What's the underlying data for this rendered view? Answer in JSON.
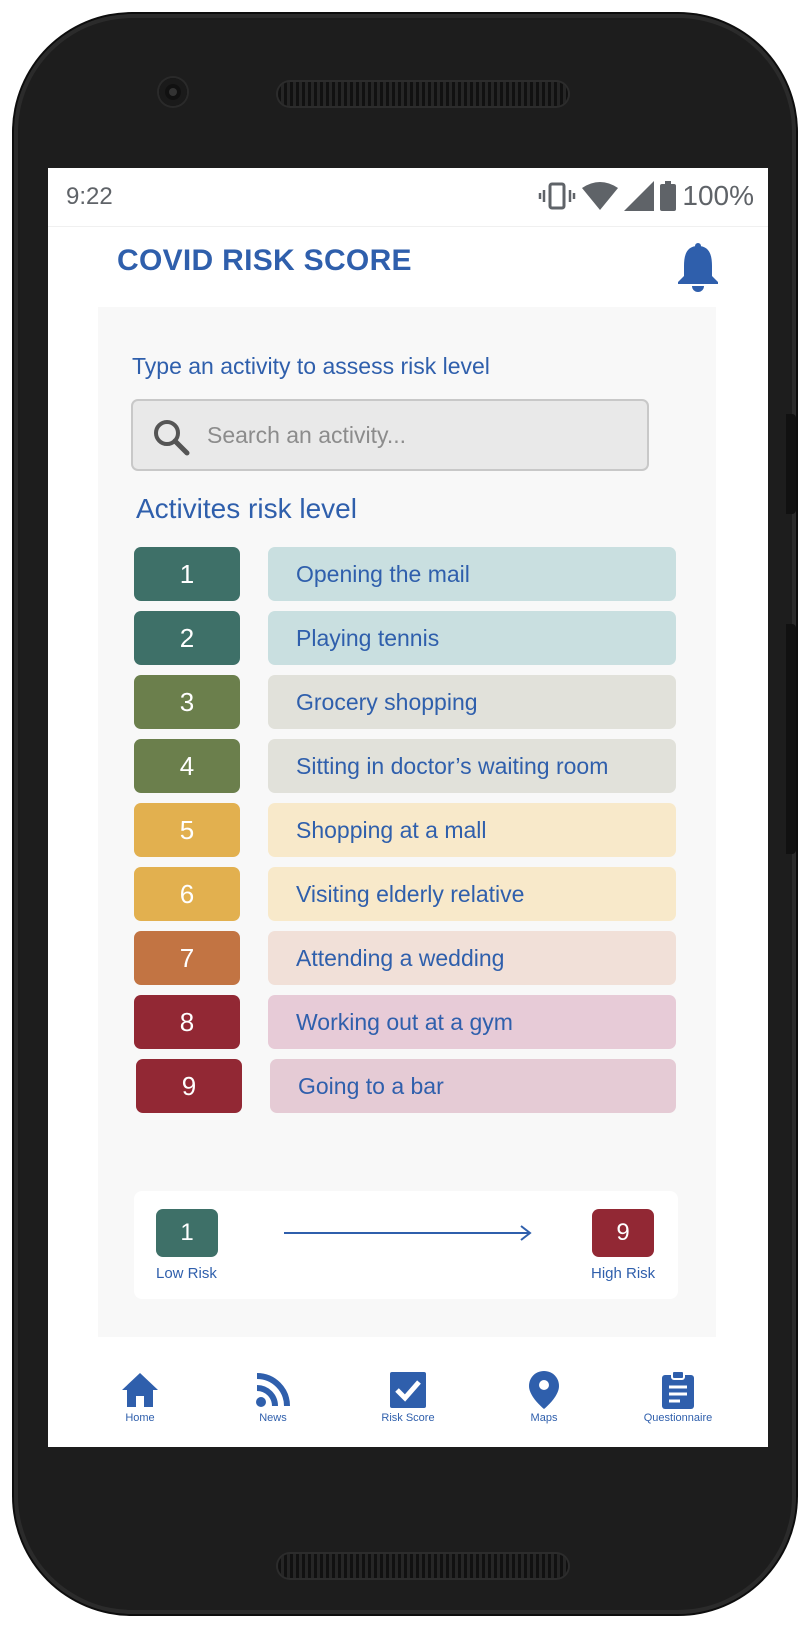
{
  "status_bar": {
    "time": "9:22",
    "battery": "100%"
  },
  "header": {
    "title": "COVID RISK SCORE"
  },
  "search": {
    "prompt": "Type an activity to assess risk level",
    "placeholder": "Search an activity..."
  },
  "activities": {
    "title": "Activites risk level",
    "items": [
      {
        "level": "1",
        "label": "Opening the mail",
        "badge_color": "#3e7068",
        "row_color": "#c9dfe0"
      },
      {
        "level": "2",
        "label": "Playing tennis",
        "badge_color": "#3e7068",
        "row_color": "#c9dfe0"
      },
      {
        "level": "3",
        "label": "Grocery shopping",
        "badge_color": "#6b7f4c",
        "row_color": "#e1e1da"
      },
      {
        "level": "4",
        "label": "Sitting in doctor’s waiting room",
        "badge_color": "#6b7f4c",
        "row_color": "#e1e1da"
      },
      {
        "level": "5",
        "label": "Shopping at a mall",
        "badge_color": "#e2b04f",
        "row_color": "#f8e9ca"
      },
      {
        "level": "6",
        "label": "Visiting elderly relative",
        "badge_color": "#e2b04f",
        "row_color": "#f8e9ca"
      },
      {
        "level": "7",
        "label": "Attending a wedding",
        "badge_color": "#c27443",
        "row_color": "#f1e0d8"
      },
      {
        "level": "8",
        "label": "Working out at a gym",
        "badge_color": "#922834",
        "row_color": "#e7cbd7"
      },
      {
        "level": "9",
        "label": "Going to a bar",
        "badge_color": "#922834",
        "row_color": "#e5cbd5"
      }
    ]
  },
  "legend": {
    "low": {
      "value": "1",
      "label": "Low Risk",
      "color": "#3e7068"
    },
    "high": {
      "value": "9",
      "label": "High Risk",
      "color": "#922834"
    }
  },
  "tab_bar": {
    "tabs": [
      {
        "label": "Home",
        "icon": "home-icon"
      },
      {
        "label": "News",
        "icon": "rss-icon"
      },
      {
        "label": "Risk Score",
        "icon": "checkbox-icon"
      },
      {
        "label": "Maps",
        "icon": "map-pin-icon"
      },
      {
        "label": "Questionnaire",
        "icon": "clipboard-icon"
      }
    ]
  },
  "colors": {
    "accent": "#2f5fac",
    "card_bg": "#f8f8f8"
  }
}
